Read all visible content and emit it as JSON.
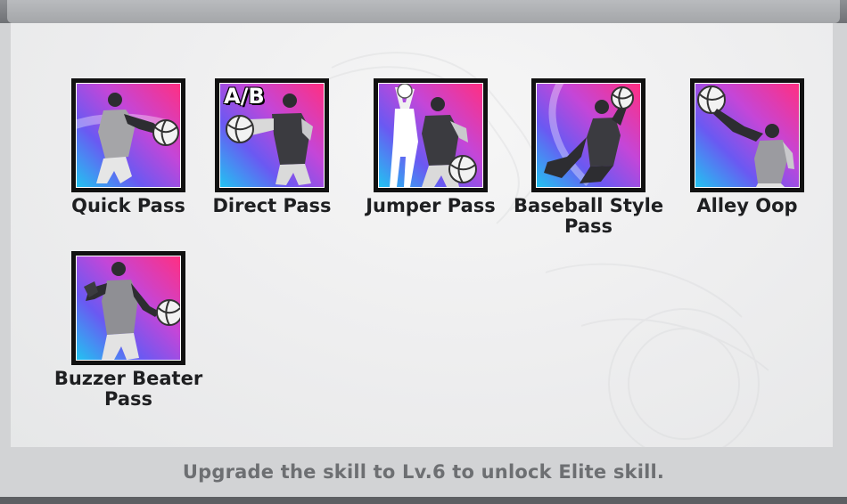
{
  "skills": [
    {
      "label": "Quick Pass",
      "icon": "quick-pass-icon"
    },
    {
      "label": "Direct Pass",
      "icon": "direct-pass-icon",
      "badge": "A/B"
    },
    {
      "label": "Jumper Pass",
      "icon": "jumper-pass-icon"
    },
    {
      "label_line1": "Baseball Style",
      "label_line2": "Pass",
      "icon": "baseball-style-pass-icon"
    },
    {
      "label": "Alley Oop",
      "icon": "alley-oop-icon"
    },
    {
      "label_line1": "Buzzer Beater",
      "label_line2": "Pass",
      "icon": "buzzer-beater-pass-icon"
    }
  ],
  "footer": {
    "hint": "Upgrade the skill to Lv.6 to unlock Elite skill."
  },
  "colors": {
    "card_gradient_start": "#ff2f82",
    "card_gradient_end": "#22c3f1",
    "label": "#1e1f21",
    "hint": "#6d6f72"
  }
}
